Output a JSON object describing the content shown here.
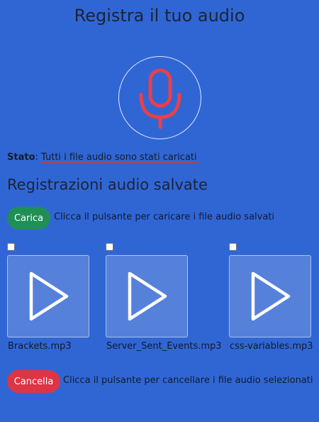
{
  "title": "Registra il tuo audio",
  "mic": {
    "icon": "microphone-icon",
    "color": "#e8404a"
  },
  "status": {
    "label": "Stato",
    "separator": ":",
    "value": "Tutti i file audio sono stati caricati"
  },
  "saved": {
    "title": "Registrazioni audio salvate",
    "upload_label": "Carica",
    "upload_hint": "Clicca il pulsante per caricare i file audio salvati",
    "files": [
      {
        "name": "Brackets.mp3",
        "checked": false
      },
      {
        "name": "Server_Sent_Events.mp3",
        "checked": false
      },
      {
        "name": "css-variables.mp3",
        "checked": false
      }
    ],
    "delete_label": "Cancella",
    "delete_hint": "Clicca il pulsante per cancellare i file audio selezionati"
  },
  "colors": {
    "background": "#3066d4",
    "upload_button": "#1f8f56",
    "delete_button": "#dc3545"
  }
}
